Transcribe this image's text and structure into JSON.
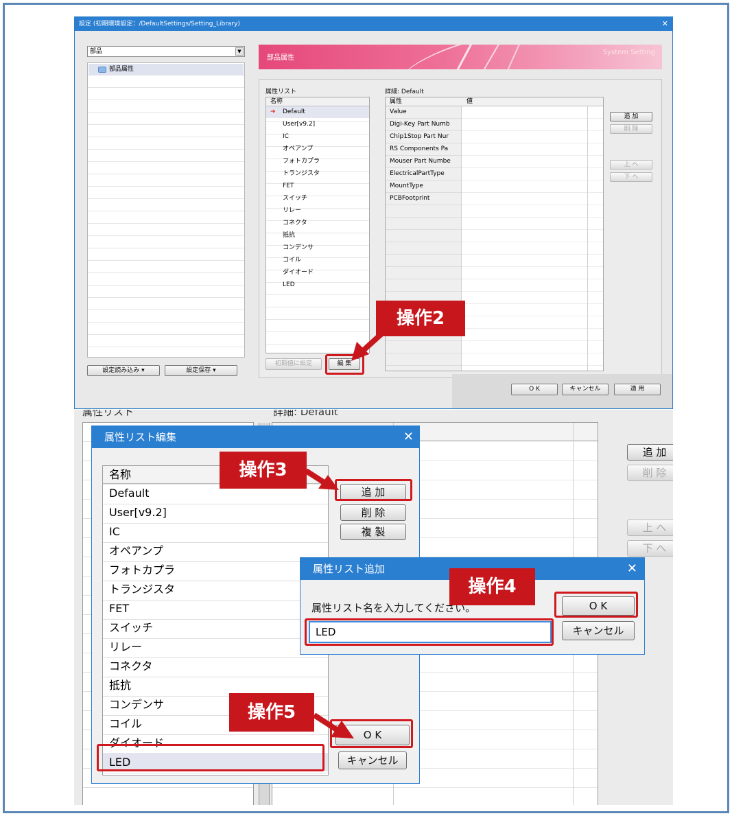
{
  "top_dialog": {
    "title": "設定 (初期環境設定：/DefaultSettings/Setting_Library)",
    "combo_value": "部品",
    "tree_node": "部品属性",
    "banner_title": "部品属性",
    "banner_right": "System Setting",
    "attr_list_label": "属性リスト",
    "attr_list_header": "名称",
    "attr_items": [
      "Default",
      "User[v9.2]",
      "IC",
      "オペアンプ",
      "フォトカプラ",
      "トランジスタ",
      "FET",
      "スイッチ",
      "リレー",
      "コネクタ",
      "抵抗",
      "コンデンサ",
      "コイル",
      "ダイオード",
      "LED"
    ],
    "detail_label": "詳細: Default",
    "detail_headers": [
      "属性",
      "値"
    ],
    "detail_rows": [
      "Value",
      "Digi-Key Part Numb",
      "Chip1Stop Part Nur",
      "RS Components Pa",
      "Mouser Part Numbe",
      "ElectricalPartType",
      "MountType",
      "PCBFootprint"
    ],
    "buttons": {
      "add": "追 加",
      "delete": "削 除",
      "up": "上 へ",
      "down": "下 へ",
      "set_initial": "初期値に設定",
      "edit": "編 集",
      "load": "設定読み込み ▾",
      "save": "設定保存 ▾",
      "ok": "O K",
      "cancel": "キャンセル",
      "apply": "適 用"
    }
  },
  "background_panel": {
    "attr_list_label": "属性リスト",
    "detail_label": "詳細: Default",
    "add": "追 加",
    "delete": "削 除",
    "up": "上 へ",
    "down": "下 へ"
  },
  "edit_dialog": {
    "title": "属性リスト編集",
    "header": "名称",
    "items": [
      "Default",
      "User[v9.2]",
      "IC",
      "オペアンプ",
      "フォトカプラ",
      "トランジスタ",
      "FET",
      "スイッチ",
      "リレー",
      "コネクタ",
      "抵抗",
      "コンデンサ",
      "コイル",
      "ダイオード",
      "LED"
    ],
    "add": "追 加",
    "delete": "削 除",
    "duplicate": "複 製",
    "ok": "O K",
    "cancel": "キャンセル"
  },
  "add_dialog": {
    "title": "属性リスト追加",
    "prompt": "属性リスト名を入力してください。",
    "input_value": "LED",
    "ok": "O K",
    "cancel": "キャンセル"
  },
  "callouts": {
    "step2": "操作2",
    "step3": "操作3",
    "step4": "操作4",
    "step5": "操作5"
  },
  "colors": {
    "titlebar": "#2b7fd1",
    "highlight": "#d0191f",
    "callout": "#c8161d",
    "frame": "#5b86b8"
  }
}
